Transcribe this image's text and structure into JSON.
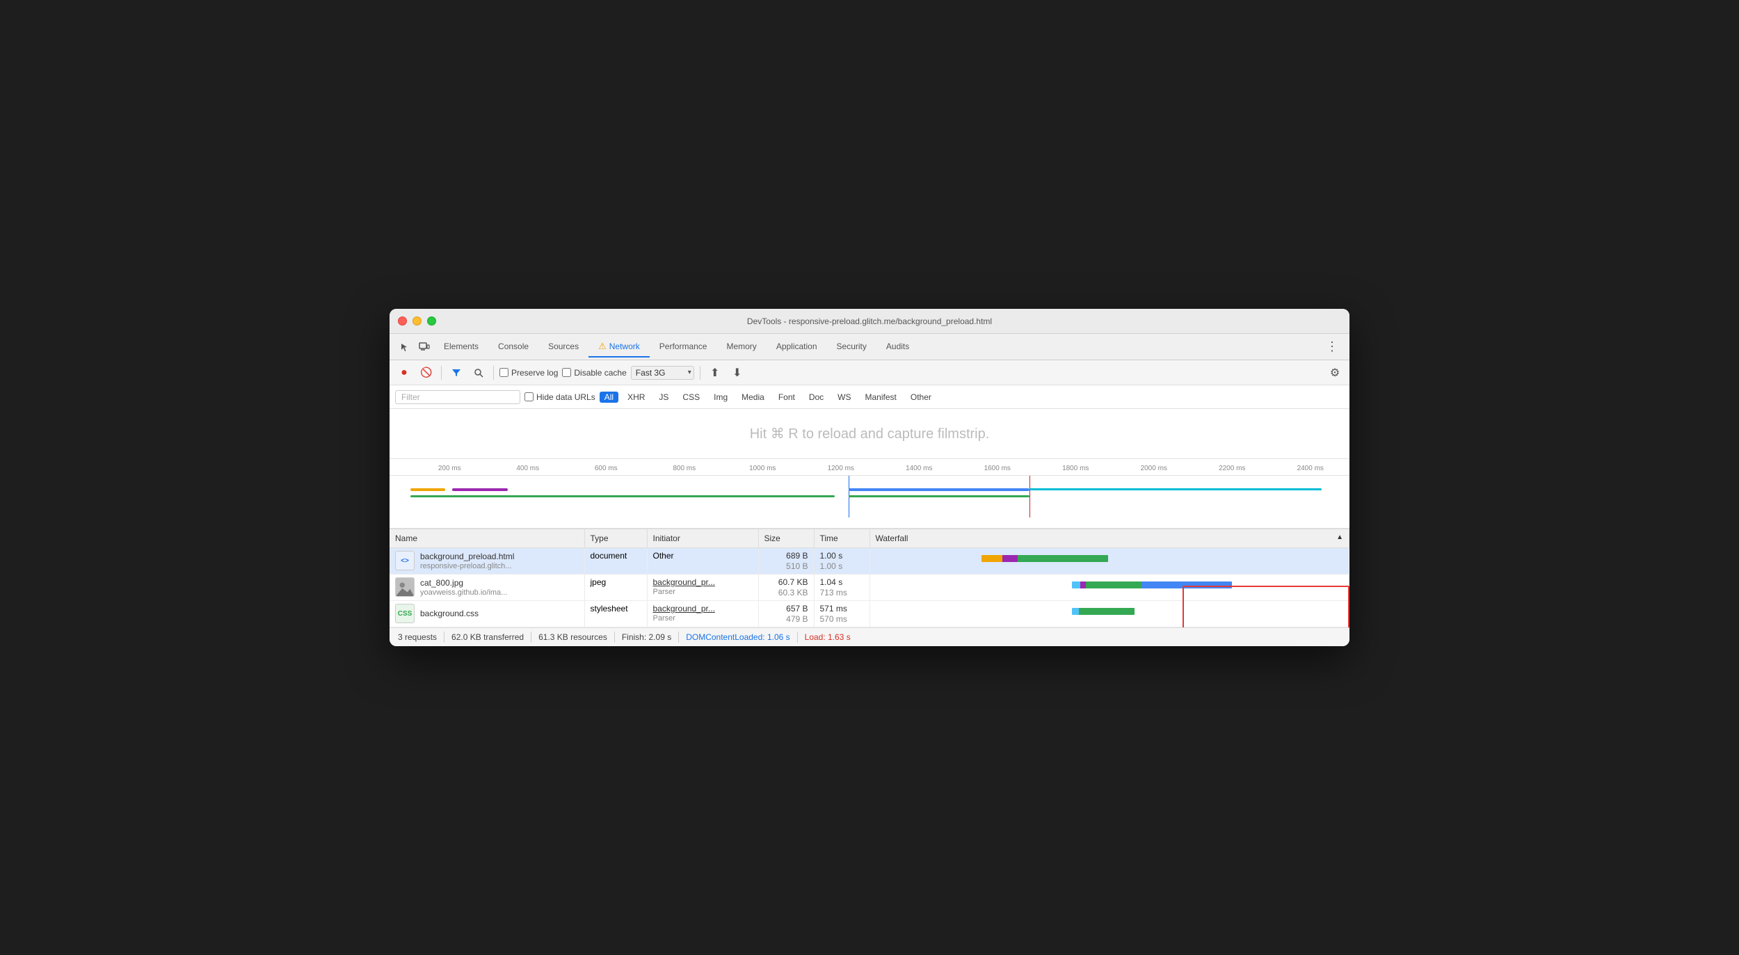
{
  "window": {
    "title": "DevTools - responsive-preload.glitch.me/background_preload.html"
  },
  "tabs": [
    {
      "label": "Elements",
      "active": false
    },
    {
      "label": "Console",
      "active": false
    },
    {
      "label": "Sources",
      "active": false
    },
    {
      "label": "Network",
      "active": true,
      "warning": true
    },
    {
      "label": "Performance",
      "active": false
    },
    {
      "label": "Memory",
      "active": false
    },
    {
      "label": "Application",
      "active": false
    },
    {
      "label": "Security",
      "active": false
    },
    {
      "label": "Audits",
      "active": false
    }
  ],
  "toolbar": {
    "preserve_log": "Preserve log",
    "disable_cache": "Disable cache",
    "throttle": "Fast 3G",
    "gear_label": "Settings"
  },
  "filter": {
    "placeholder": "Filter",
    "hide_data_urls": "Hide data URLs",
    "types": [
      "All",
      "XHR",
      "JS",
      "CSS",
      "Img",
      "Media",
      "Font",
      "Doc",
      "WS",
      "Manifest",
      "Other"
    ],
    "active_type": "All"
  },
  "filmstrip": {
    "hint": "Hit ⌘ R to reload and capture filmstrip."
  },
  "timeline": {
    "ticks": [
      "200 ms",
      "400 ms",
      "600 ms",
      "800 ms",
      "1000 ms",
      "1200 ms",
      "1400 ms",
      "1600 ms",
      "1800 ms",
      "2000 ms",
      "2200 ms",
      "2400 ms"
    ]
  },
  "table": {
    "headers": [
      "Name",
      "Type",
      "Initiator",
      "Size",
      "Time",
      "Waterfall"
    ],
    "rows": [
      {
        "name": "background_preload.html",
        "name_sub": "responsive-preload.glitch...",
        "icon_type": "html",
        "icon_text": "<>",
        "type": "document",
        "initiator": "Other",
        "initiator_sub": "",
        "size": "689 B",
        "size_sub": "510 B",
        "time": "1.00 s",
        "time_sub": "1.00 s"
      },
      {
        "name": "cat_800.jpg",
        "name_sub": "yoavweiss.github.io/ima...",
        "icon_type": "jpeg",
        "icon_text": "IMG",
        "type": "jpeg",
        "initiator": "background_pr...",
        "initiator_sub": "Parser",
        "size": "60.7 KB",
        "size_sub": "60.3 KB",
        "time": "1.04 s",
        "time_sub": "713 ms"
      },
      {
        "name": "background.css",
        "name_sub": "",
        "icon_type": "css",
        "icon_text": "CSS",
        "type": "stylesheet",
        "initiator": "background_pr...",
        "initiator_sub": "Parser",
        "size": "657 B",
        "size_sub": "479 B",
        "time": "571 ms",
        "time_sub": "570 ms"
      }
    ]
  },
  "status_bar": {
    "requests": "3 requests",
    "transferred": "62.0 KB transferred",
    "resources": "61.3 KB resources",
    "finish": "Finish: 2.09 s",
    "dom_content_loaded": "DOMContentLoaded: 1.06 s",
    "load": "Load: 1.63 s"
  }
}
